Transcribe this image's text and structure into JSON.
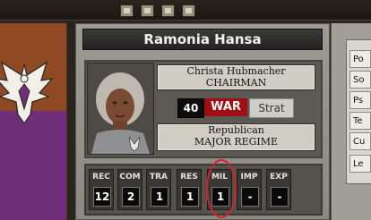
{
  "leader": {
    "name": "Ramonia Hansa",
    "person": "Christa Hubmacher",
    "role": "CHAIRMAN",
    "level": "40",
    "stance": "WAR",
    "strat_label": "Strat",
    "ideology": "Republican",
    "regime": "MAJOR REGIME"
  },
  "ratings": [
    {
      "label": "REC",
      "value": "12"
    },
    {
      "label": "COM",
      "value": "2"
    },
    {
      "label": "TRA",
      "value": "1"
    },
    {
      "label": "RES",
      "value": "1"
    },
    {
      "label": "MIL",
      "value": "1"
    },
    {
      "label": "IMP",
      "value": "-"
    },
    {
      "label": "EXP",
      "value": "-"
    }
  ],
  "side_menu": [
    "Po",
    "So",
    "Ps",
    "Te",
    "Cu",
    "Le"
  ],
  "colors": {
    "war_red": "#a10f12",
    "banner_orange": "#8d4a23",
    "banner_purple": "#6f2d7a",
    "highlight_circle": "#d4222a"
  }
}
